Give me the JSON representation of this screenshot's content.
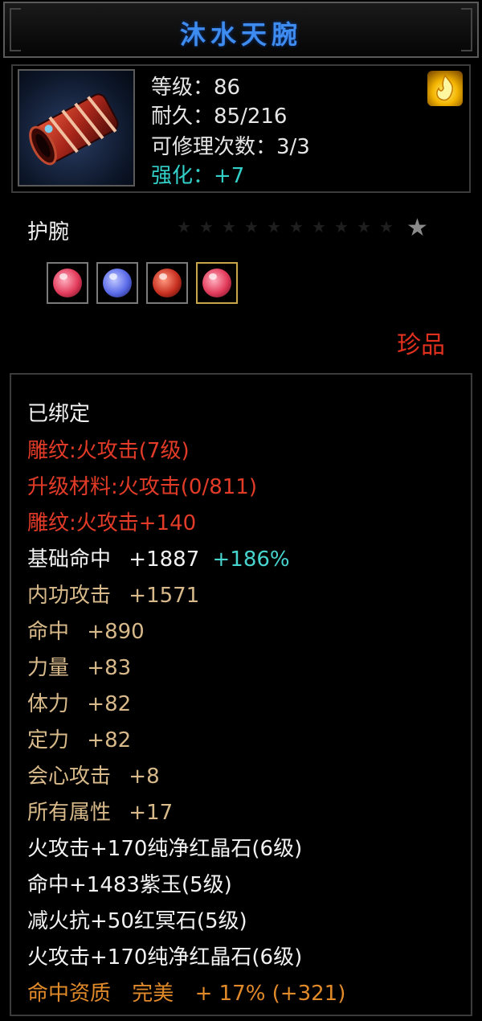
{
  "title": "沐水天腕",
  "item": {
    "icon": "bracer-icon",
    "level_line": "等级：86",
    "durability_line": "耐久：85/216",
    "repair_line": "可修理次数：3/3",
    "enhance_line": "强化：+7",
    "badge_icon": "flame-icon"
  },
  "type": "护腕",
  "stars": {
    "filled": 0,
    "total": 1,
    "icon": "star-icon"
  },
  "gems": [
    {
      "icon": "red-crystal-icon",
      "color": "#e23a5a"
    },
    {
      "icon": "purple-jade-icon",
      "color": "#5a6ae8"
    },
    {
      "icon": "red-stone-icon",
      "color": "#c83020"
    },
    {
      "icon": "red-crystal-icon",
      "color": "#e23a5a"
    }
  ],
  "rarity": "珍品",
  "attributes": {
    "bound": "已绑定",
    "engrave_1": "雕纹:火攻击(7级)",
    "upgrade_material": "升级材料:火攻击(0/811)",
    "engrave_2": "雕纹:火攻击+140",
    "base_hit": {
      "label": "基础命中",
      "value": "+1887",
      "bonus": "+186%"
    },
    "inner_attack": {
      "label": "内功攻击",
      "value": "+1571"
    },
    "hit": {
      "label": "命中",
      "value": "+890"
    },
    "strength": {
      "label": "力量",
      "value": "+83"
    },
    "stamina": {
      "label": "体力",
      "value": "+82"
    },
    "focus": {
      "label": "定力",
      "value": "+82"
    },
    "crit_attack": {
      "label": "会心攻击",
      "value": "+8"
    },
    "all_attrs": {
      "label": "所有属性",
      "value": "+17"
    },
    "gem_line_1": "火攻击+170纯净红晶石(6级)",
    "gem_line_2": "命中+1483紫玉(5级)",
    "gem_line_3": "减火抗+50红冥石(5级)",
    "gem_line_4": "火攻击+170纯净红晶石(6级)",
    "quality": {
      "label": "命中资质",
      "grade": "完美",
      "value": "+ 17% (+321)"
    }
  },
  "colors": {
    "title": "#3f8cf0",
    "red_text": "#e23b28",
    "tan_text": "#d8b98a",
    "cyan_text": "#47d4cf",
    "orange_text": "#e08a2a"
  }
}
